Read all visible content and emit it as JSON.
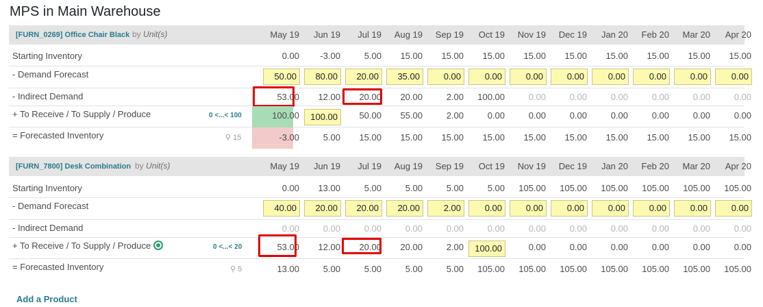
{
  "page_title": "MPS in Main Warehouse",
  "months": [
    "May 19",
    "Jun 19",
    "Jul 19",
    "Aug 19",
    "Sep 19",
    "Oct 19",
    "Nov 19",
    "Dec 19",
    "Jan 20",
    "Feb 20",
    "Mar 20",
    "Apr 20"
  ],
  "by_prefix": "by",
  "unit": "Unit(s)",
  "add_product": "Add a Product",
  "products": [
    {
      "name": "[FURN_0269] Office Chair Black",
      "safety_range": "0 <...< 100",
      "pin_count": "15",
      "rows": {
        "starting_inventory": {
          "label": "Starting Inventory",
          "values": [
            "0.00",
            "-3.00",
            "5.00",
            "15.00",
            "15.00",
            "15.00",
            "15.00",
            "15.00",
            "15.00",
            "15.00",
            "15.00",
            "15.00"
          ]
        },
        "demand_forecast": {
          "label": "-  Demand Forecast",
          "values": [
            "50.00",
            "80.00",
            "20.00",
            "35.00",
            "0.00",
            "0.00",
            "0.00",
            "0.00",
            "0.00",
            "0.00",
            "0.00",
            "0.00"
          ]
        },
        "indirect_demand": {
          "label": "-  Indirect Demand",
          "values": [
            "53.00",
            "12.00",
            "20.00",
            "20.00",
            "2.00",
            "100.00",
            "0.00",
            "0.00",
            "0.00",
            "0.00",
            "0.00",
            "0.00"
          ]
        },
        "to_receive": {
          "label": "+  To Receive / To Supply / Produce",
          "values": [
            "100.00",
            "100.00",
            "50.00",
            "55.00",
            "2.00",
            "0.00",
            "0.00",
            "0.00",
            "0.00",
            "0.00",
            "0.00",
            "0.00"
          ]
        },
        "forecasted_inventory": {
          "label": "=  Forecasted Inventory",
          "values": [
            "-3.00",
            "5.00",
            "15.00",
            "15.00",
            "15.00",
            "15.00",
            "15.00",
            "15.00",
            "15.00",
            "15.00",
            "15.00",
            "15.00"
          ]
        }
      }
    },
    {
      "name": "[FURN_7800] Desk Combination",
      "safety_range": "0 <...< 20",
      "pin_count": "5",
      "rows": {
        "starting_inventory": {
          "label": "Starting Inventory",
          "values": [
            "0.00",
            "13.00",
            "5.00",
            "5.00",
            "5.00",
            "5.00",
            "105.00",
            "105.00",
            "105.00",
            "105.00",
            "105.00",
            "105.00"
          ]
        },
        "demand_forecast": {
          "label": "-  Demand Forecast",
          "values": [
            "40.00",
            "20.00",
            "20.00",
            "20.00",
            "2.00",
            "0.00",
            "0.00",
            "0.00",
            "0.00",
            "0.00",
            "0.00",
            "0.00"
          ]
        },
        "indirect_demand": {
          "label": "-  Indirect Demand",
          "values": [
            "0.00",
            "0.00",
            "0.00",
            "0.00",
            "0.00",
            "0.00",
            "0.00",
            "0.00",
            "0.00",
            "0.00",
            "0.00",
            "0.00"
          ]
        },
        "to_receive": {
          "label": "+  To Receive / To Supply / Produce",
          "values": [
            "53.00",
            "12.00",
            "20.00",
            "20.00",
            "2.00",
            "100.00",
            "0.00",
            "0.00",
            "0.00",
            "0.00",
            "0.00",
            "0.00"
          ]
        },
        "forecasted_inventory": {
          "label": "=  Forecasted Inventory",
          "values": [
            "13.00",
            "5.00",
            "5.00",
            "5.00",
            "5.00",
            "105.00",
            "105.00",
            "105.00",
            "105.00",
            "105.00",
            "105.00",
            "105.00"
          ]
        }
      }
    }
  ],
  "icons": {
    "pin": "map-marker-icon",
    "target": "target-icon"
  },
  "colors": {
    "input_bg": "#fcf9b0",
    "highlight": "#e00000",
    "positive_cell": "#a8dcb6",
    "negative_cell": "#f3caca",
    "link": "#2a7b8c"
  }
}
